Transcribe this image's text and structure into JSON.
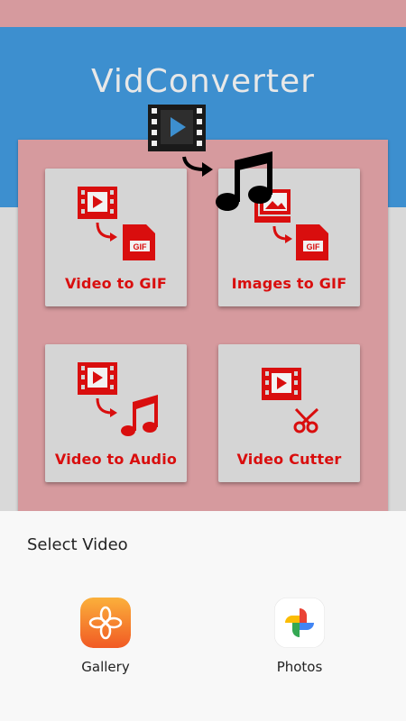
{
  "app": {
    "title": "VidConverter"
  },
  "tiles": [
    {
      "label": "Video to GIF",
      "icon": "video-to-gif-icon"
    },
    {
      "label": "Images to GIF",
      "icon": "images-to-gif-icon"
    },
    {
      "label": "Video to Audio",
      "icon": "video-to-audio-icon"
    },
    {
      "label": "Video Cutter",
      "icon": "video-cutter-icon"
    }
  ],
  "sheet": {
    "title": "Select Video",
    "options": [
      {
        "label": "Gallery",
        "icon": "gallery-icon"
      },
      {
        "label": "Photos",
        "icon": "photos-icon"
      }
    ]
  },
  "colors": {
    "accent_red": "#d90e0e",
    "header_blue": "#3d8fcf",
    "panel_pink": "#d69a9e"
  }
}
